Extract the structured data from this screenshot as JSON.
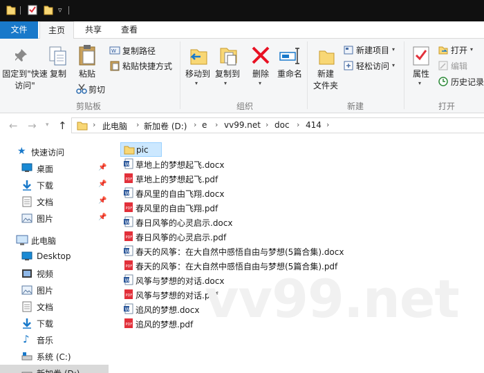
{
  "title_bar": {
    "dropdown_glyph": "▿"
  },
  "tabs": [
    {
      "label": "文件"
    },
    {
      "label": "主页"
    },
    {
      "label": "共享"
    },
    {
      "label": "查看"
    }
  ],
  "ribbon": {
    "clipboard": {
      "pin_label": "固定到\"快速访问\"",
      "copy_label": "复制",
      "paste_label": "粘贴",
      "copy_path_label": "复制路径",
      "paste_shortcut_label": "粘贴快捷方式",
      "cut_label": "剪切",
      "group_label": "剪贴板"
    },
    "organize": {
      "move_to_label": "移动到",
      "copy_to_label": "复制到",
      "delete_label": "删除",
      "rename_label": "重命名",
      "group_label": "组织"
    },
    "new": {
      "new_folder_label": "新建\n文件夹",
      "new_item_label": "新建项目",
      "easy_access_label": "轻松访问",
      "group_label": "新建"
    },
    "open": {
      "properties_label": "属性",
      "open_label": "打开",
      "edit_label": "编辑",
      "history_label": "历史记录",
      "group_label": "打开"
    }
  },
  "address": {
    "breadcrumbs": [
      "此电脑",
      "新加卷 (D:)",
      "e",
      "vv99.net",
      "doc",
      "414"
    ],
    "separator": "›",
    "expand_glyph": "⌄"
  },
  "nav_pane": {
    "items": [
      {
        "label": "快速访问",
        "icon": "star-icon"
      },
      {
        "label": "桌面",
        "icon": "desktop-icon",
        "pinned": true
      },
      {
        "label": "下载",
        "icon": "download-icon",
        "pinned": true
      },
      {
        "label": "文档",
        "icon": "documents-icon",
        "pinned": true
      },
      {
        "label": "图片",
        "icon": "pictures-icon",
        "pinned": true
      },
      {
        "label": "此电脑",
        "icon": "computer-icon"
      },
      {
        "label": "Desktop",
        "icon": "desktop-icon"
      },
      {
        "label": "视频",
        "icon": "video-icon"
      },
      {
        "label": "图片",
        "icon": "pictures-icon"
      },
      {
        "label": "文档",
        "icon": "documents-icon"
      },
      {
        "label": "下载",
        "icon": "download-icon"
      },
      {
        "label": "音乐",
        "icon": "music-icon"
      },
      {
        "label": "系统 (C:)",
        "icon": "drive-icon"
      },
      {
        "label": "新加卷 (D:)",
        "icon": "drive-icon"
      }
    ]
  },
  "files": [
    {
      "name": "pic",
      "type": "folder"
    },
    {
      "name": "草地上的梦想起飞.docx",
      "type": "docx"
    },
    {
      "name": "草地上的梦想起飞.pdf",
      "type": "pdf"
    },
    {
      "name": "春风里的自由飞翔.docx",
      "type": "docx"
    },
    {
      "name": "春风里的自由飞翔.pdf",
      "type": "pdf"
    },
    {
      "name": "春日风筝的心灵启示.docx",
      "type": "docx"
    },
    {
      "name": "春日风筝的心灵启示.pdf",
      "type": "pdf"
    },
    {
      "name": "春天的风筝：在大自然中感悟自由与梦想(5篇合集).docx",
      "type": "docx"
    },
    {
      "name": "春天的风筝：在大自然中感悟自由与梦想(5篇合集).pdf",
      "type": "pdf"
    },
    {
      "name": "风筝与梦想的对话.docx",
      "type": "docx"
    },
    {
      "name": "风筝与梦想的对话.pdf",
      "type": "pdf"
    },
    {
      "name": "追风的梦想.docx",
      "type": "docx"
    },
    {
      "name": "追风的梦想.pdf",
      "type": "pdf"
    }
  ],
  "watermark": "vv99.net",
  "colors": {
    "accent": "#1979ca",
    "selection": "#cce8ff",
    "folder": "#f8d775",
    "word": "#2b579a",
    "pdf": "#e2303a",
    "delete": "#e81123"
  }
}
